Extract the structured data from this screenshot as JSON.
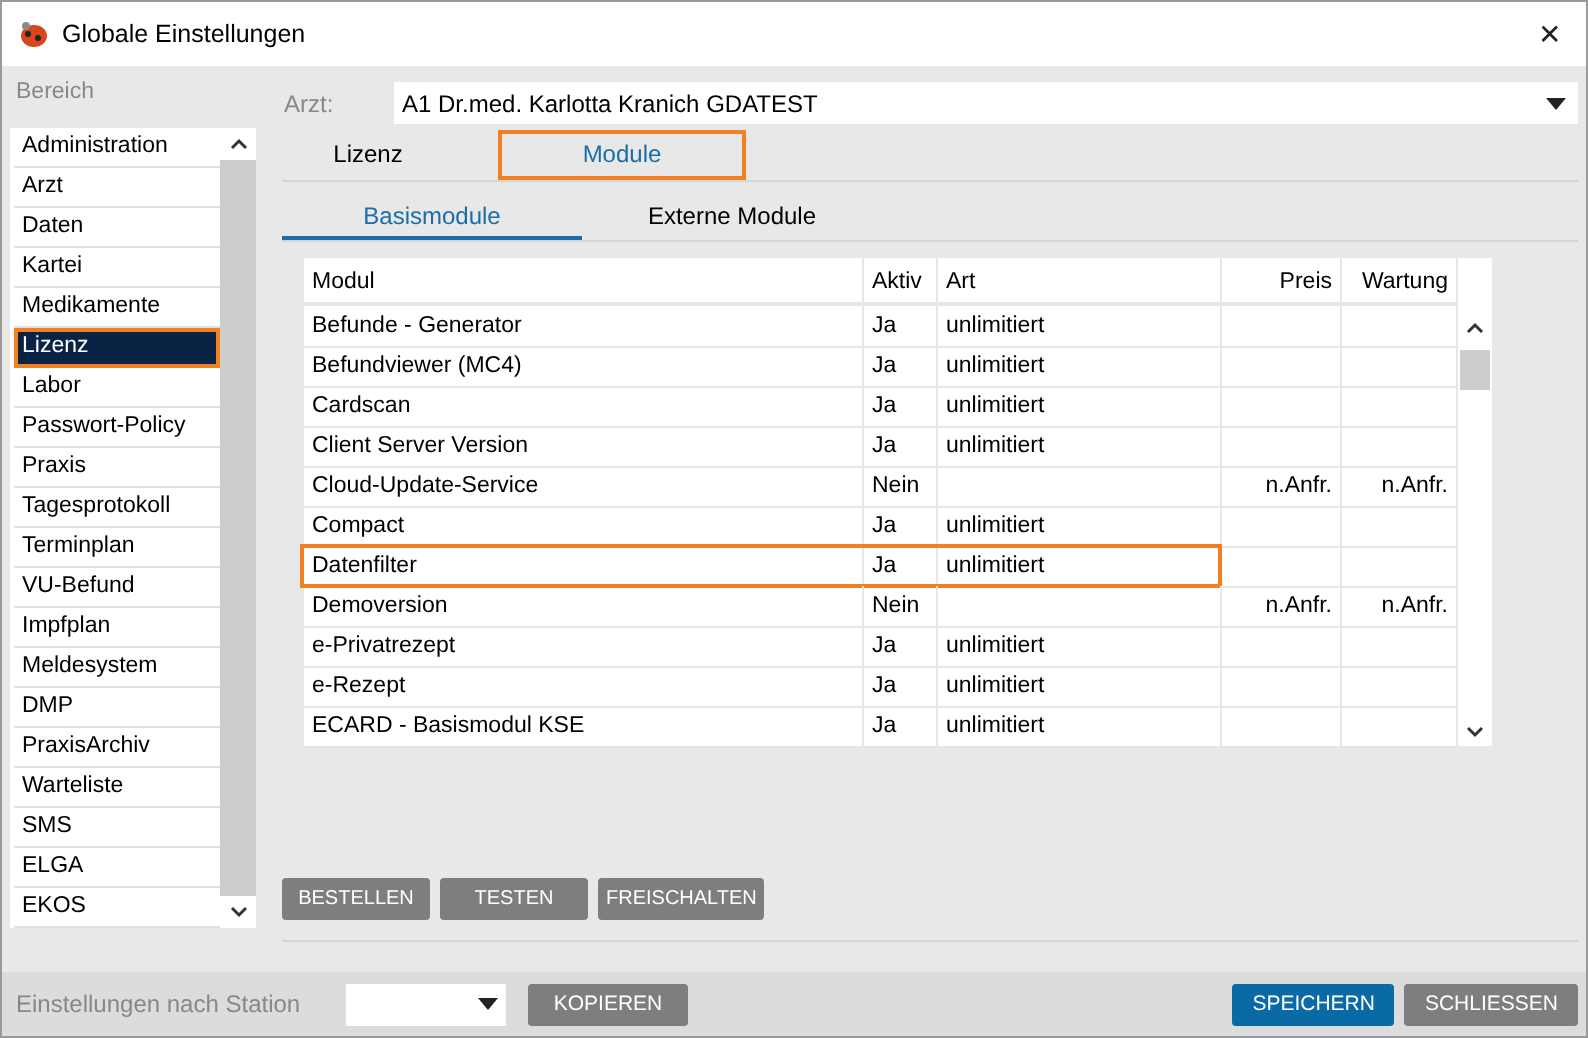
{
  "window": {
    "title": "Globale Einstellungen",
    "close": "✕"
  },
  "sidebar": {
    "label": "Bereich",
    "items": [
      {
        "label": "Administration",
        "selected": false
      },
      {
        "label": "Arzt",
        "selected": false
      },
      {
        "label": "Daten",
        "selected": false
      },
      {
        "label": "Kartei",
        "selected": false
      },
      {
        "label": "Medikamente",
        "selected": false
      },
      {
        "label": "Lizenz",
        "selected": true
      },
      {
        "label": "Labor",
        "selected": false
      },
      {
        "label": "Passwort-Policy",
        "selected": false
      },
      {
        "label": "Praxis",
        "selected": false
      },
      {
        "label": "Tagesprotokoll",
        "selected": false
      },
      {
        "label": "Terminplan",
        "selected": false
      },
      {
        "label": "VU-Befund",
        "selected": false
      },
      {
        "label": "Impfplan",
        "selected": false
      },
      {
        "label": "Meldesystem",
        "selected": false
      },
      {
        "label": "DMP",
        "selected": false
      },
      {
        "label": "PraxisArchiv",
        "selected": false
      },
      {
        "label": "Warteliste",
        "selected": false
      },
      {
        "label": "SMS",
        "selected": false
      },
      {
        "label": "ELGA",
        "selected": false
      },
      {
        "label": "EKOS",
        "selected": false
      }
    ]
  },
  "arzt": {
    "label": "Arzt:",
    "value": "A1 Dr.med. Karlotta Kranich GDATEST"
  },
  "tabs": [
    {
      "label": "Lizenz",
      "selected": false,
      "highlighted": false
    },
    {
      "label": "Module",
      "selected": true,
      "highlighted": true
    }
  ],
  "subtabs": [
    {
      "label": "Basismodule",
      "selected": true
    },
    {
      "label": "Externe Module",
      "selected": false
    }
  ],
  "table": {
    "columns": [
      "Modul",
      "Aktiv",
      "Art",
      "Preis",
      "Wartung"
    ],
    "rows": [
      {
        "cells": [
          "Befunde - Generator",
          "Ja",
          "unlimitiert",
          "",
          ""
        ],
        "highlighted": false
      },
      {
        "cells": [
          "Befundviewer (MC4)",
          "Ja",
          "unlimitiert",
          "",
          ""
        ],
        "highlighted": false
      },
      {
        "cells": [
          "Cardscan",
          "Ja",
          "unlimitiert",
          "",
          ""
        ],
        "highlighted": false
      },
      {
        "cells": [
          "Client Server Version",
          "Ja",
          "unlimitiert",
          "",
          ""
        ],
        "highlighted": false
      },
      {
        "cells": [
          "Cloud-Update-Service",
          "Nein",
          "",
          "n.Anfr.",
          "n.Anfr."
        ],
        "highlighted": false
      },
      {
        "cells": [
          "Compact",
          "Ja",
          "unlimitiert",
          "",
          ""
        ],
        "highlighted": false
      },
      {
        "cells": [
          "Datenfilter",
          "Ja",
          "unlimitiert",
          "",
          ""
        ],
        "highlighted": true
      },
      {
        "cells": [
          "Demoversion",
          "Nein",
          "",
          "n.Anfr.",
          "n.Anfr."
        ],
        "highlighted": false
      },
      {
        "cells": [
          "e-Privatrezept",
          "Ja",
          "unlimitiert",
          "",
          ""
        ],
        "highlighted": false
      },
      {
        "cells": [
          "e-Rezept",
          "Ja",
          "unlimitiert",
          "",
          ""
        ],
        "highlighted": false
      },
      {
        "cells": [
          "ECARD - Basismodul KSE",
          "Ja",
          "unlimitiert",
          "",
          ""
        ],
        "highlighted": false
      }
    ]
  },
  "actions": [
    "BESTELLEN",
    "TESTEN",
    "FREISCHALTEN"
  ],
  "footer": {
    "station_label": "Einstellungen nach Station",
    "copy": "KOPIEREN",
    "buttons": [
      {
        "label": "SPEICHERN",
        "primary": true
      },
      {
        "label": "SCHLIESSEN",
        "primary": false
      }
    ]
  }
}
